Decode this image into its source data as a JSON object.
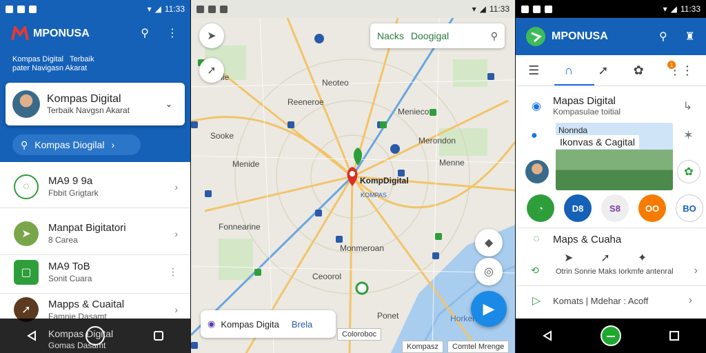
{
  "status": {
    "time_left": "11:33",
    "time_mid": "11:33",
    "time_right": "11:33"
  },
  "panel1": {
    "brand": "MPONUSA",
    "subtitle_a": "Kompas Digital",
    "subtitle_b": "Terbaik",
    "subtitle_c": "pater Navigasn Akarat",
    "card_title": "Kompas Digital",
    "card_sub": "Terbaik Navgsn Akarat",
    "search_pill": "Kompas Diogilal",
    "items": [
      {
        "title": "MA9 9 9a",
        "sub": "Fbbit Grigtark",
        "color": "#ffffff",
        "icon": "chat-icon"
      },
      {
        "title": "Manpat Bigitatori",
        "sub": "8 Carea",
        "color": "#7aa64a",
        "icon": "leaf-icon"
      },
      {
        "title": "MA9 ToB",
        "sub": "Sonit Cuara",
        "color": "#2e9e3a",
        "icon": "square-icon"
      },
      {
        "title": "Mapps & Cuaital",
        "sub": "Famnie Dasamt",
        "color": "#5b3a1f",
        "icon": "arrow-icon"
      },
      {
        "title": "Kompas Digital",
        "sub": "Gomas Dasamt",
        "color": "#1561b8",
        "icon": "globe-icon"
      }
    ]
  },
  "panel2": {
    "search_a": "Nacks",
    "search_b": "Doogigal",
    "pin_label": "KompDigital",
    "pin_sub": "KOMPAS",
    "places": [
      "Fmnie",
      "Reeneroe",
      "Sooke",
      "Menide",
      "Menieco",
      "Merondon",
      "Menne",
      "Fonnearine",
      "Monmeroan",
      "Ceoorol",
      "Neoteo",
      "Ponet",
      "Horkenso"
    ],
    "bottom_card": "Kompas Digita",
    "bottom_card_b": "Brela",
    "chip_a": "Coloroboc",
    "chip_b": "Kompasz",
    "chip_c": "Comtel Mrenge"
  },
  "panel3": {
    "brand": "MPONUSA",
    "badge": "1",
    "row1_title": "Mapas Digital",
    "row1_sub": "Kompasulae toitial",
    "photo_label": "Nonnda",
    "photo_title": "Ikonvas & Cagital",
    "circles": [
      "",
      "D8",
      "S8",
      "OO",
      "BO"
    ],
    "row2_title": "Maps & Cuaha",
    "row2_sub": "Otrin Sonrie Maks Iorkmfe antenral",
    "row3_title": "Komats | Mdehar : Acoff"
  }
}
